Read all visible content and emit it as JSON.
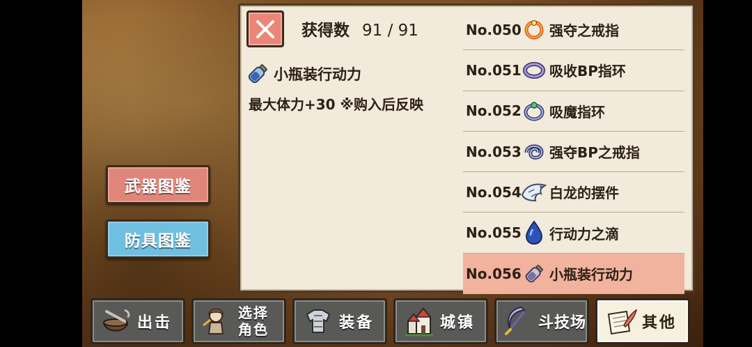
{
  "panel": {
    "count_label": "获得数",
    "count_value": "91 / 91",
    "detail": {
      "name": "小瓶装行动力",
      "description": "最大体力+30 ※购入后反映"
    }
  },
  "side_buttons": {
    "weapon": "武器图鉴",
    "armor": "防具图鉴"
  },
  "items": [
    {
      "no": "No.050",
      "name": "强夺之戒指",
      "icon": "red-ring-icon"
    },
    {
      "no": "No.051",
      "name": "吸收BP指环",
      "icon": "purple-ring-icon"
    },
    {
      "no": "No.052",
      "name": "吸魔指环",
      "icon": "gem-ring-icon"
    },
    {
      "no": "No.053",
      "name": "强夺BP之戒指",
      "icon": "twisted-ring-icon"
    },
    {
      "no": "No.054",
      "name": "白龙的摆件",
      "icon": "white-dragon-icon"
    },
    {
      "no": "No.055",
      "name": "行动力之滴",
      "icon": "blue-drop-icon"
    },
    {
      "no": "No.056",
      "name": "小瓶装行动力",
      "icon": "small-bottle-icon",
      "selected": true
    }
  ],
  "nav": {
    "sortie": "出击",
    "select_role_1": "选择",
    "select_role_2": "角色",
    "equip": "装备",
    "town": "城镇",
    "arena": "斗技场",
    "other": "其他"
  },
  "colors": {
    "weapon_button": "#e0857a",
    "armor_button": "#6fbfe0",
    "selected_row": "#f1b29e",
    "close_button": "#ea8577"
  }
}
